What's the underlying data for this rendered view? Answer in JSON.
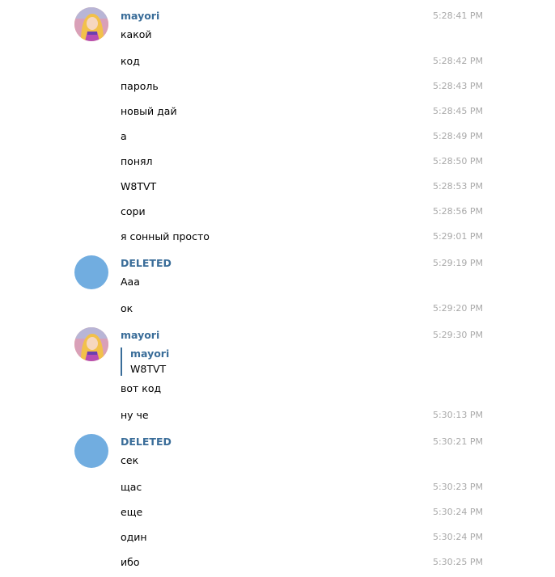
{
  "groups": [
    {
      "user": "mayori",
      "messages": [
        {
          "text": "какой",
          "time": "5:28:41 PM"
        },
        {
          "text": "код",
          "time": "5:28:42 PM"
        },
        {
          "text": "пароль",
          "time": "5:28:43 PM"
        },
        {
          "text": "новый дай",
          "time": "5:28:45 PM"
        },
        {
          "text": "а",
          "time": "5:28:49 PM"
        },
        {
          "text": "понял",
          "time": "5:28:50 PM"
        },
        {
          "text": "W8TVT",
          "time": "5:28:53 PM"
        },
        {
          "text": "сори",
          "time": "5:28:56 PM"
        },
        {
          "text": "я сонный просто",
          "time": "5:29:01 PM"
        }
      ]
    },
    {
      "user": "DELETED",
      "messages": [
        {
          "text": "Ааа",
          "time": "5:29:19 PM"
        },
        {
          "text": "ок",
          "time": "5:29:20 PM"
        }
      ]
    },
    {
      "user": "mayori",
      "header_time": "5:29:30 PM",
      "quote": {
        "name": "mayori",
        "text": "W8TVT"
      },
      "messages": [
        {
          "text": "вот код",
          "time": ""
        },
        {
          "text": "ну че",
          "time": "5:30:13 PM"
        }
      ]
    },
    {
      "user": "DELETED",
      "messages": [
        {
          "text": "сек",
          "time": "5:30:21 PM"
        },
        {
          "text": "щас",
          "time": "5:30:23 PM"
        },
        {
          "text": "еще",
          "time": "5:30:24 PM"
        },
        {
          "text": "один",
          "time": "5:30:24 PM"
        },
        {
          "text": "ибо",
          "time": "5:30:25 PM"
        }
      ]
    }
  ],
  "colors": {
    "name": "#3a6d99",
    "time": "#a9a9a9",
    "deleted_avatar": "#71ade0"
  },
  "icons": {
    "mayori_avatar": "anime-girl-avatar",
    "deleted_avatar": "blank-circle-avatar"
  }
}
